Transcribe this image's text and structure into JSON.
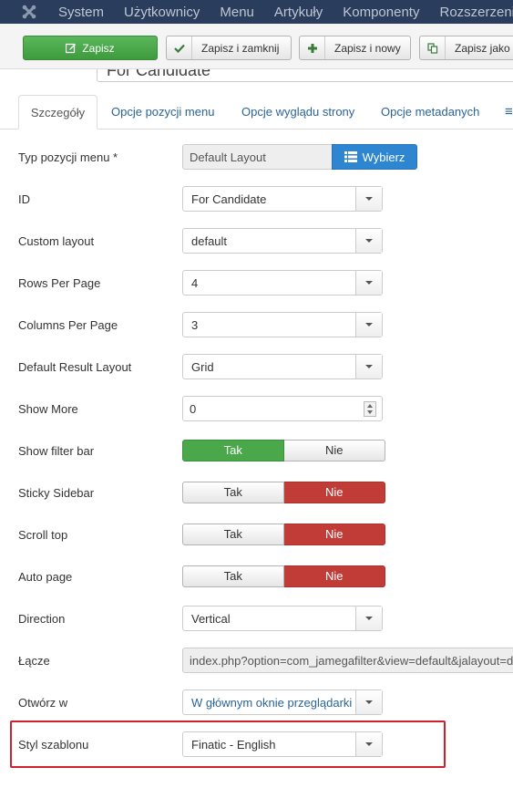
{
  "navbar": {
    "menu": [
      "System",
      "Użytkownicy",
      "Menu",
      "Artykuły",
      "Komponenty",
      "Rozszerzenia"
    ]
  },
  "toolbar": {
    "save": "Zapisz",
    "save_close": "Zapisz i zamknij",
    "save_new": "Zapisz i nowy",
    "save_copy": "Zapisz jako"
  },
  "title_field": {
    "label_fragment": "'",
    "value": "For Candidate"
  },
  "tabs": [
    "Szczegóły",
    "Opcje pozycji menu",
    "Opcje wyglądu strony",
    "Opcje metadanych",
    "≡"
  ],
  "form": {
    "menu_type": {
      "label": "Typ pozycji menu *",
      "value": "Default Layout",
      "button": "Wybierz"
    },
    "id": {
      "label": "ID",
      "value": "For Candidate"
    },
    "custom_layout": {
      "label": "Custom layout",
      "value": "default"
    },
    "rows_per_page": {
      "label": "Rows Per Page",
      "value": "4"
    },
    "columns_per_page": {
      "label": "Columns Per Page",
      "value": "3"
    },
    "default_result_layout": {
      "label": "Default Result Layout",
      "value": "Grid"
    },
    "show_more": {
      "label": "Show More",
      "value": "0"
    },
    "show_filter_bar": {
      "label": "Show filter bar",
      "yes": "Tak",
      "no": "Nie",
      "selected": "Tak"
    },
    "sticky_sidebar": {
      "label": "Sticky Sidebar",
      "yes": "Tak",
      "no": "Nie",
      "selected": "Nie"
    },
    "scroll_top": {
      "label": "Scroll top",
      "yes": "Tak",
      "no": "Nie",
      "selected": "Nie"
    },
    "auto_page": {
      "label": "Auto page",
      "yes": "Tak",
      "no": "Nie",
      "selected": "Nie"
    },
    "direction": {
      "label": "Direction",
      "value": "Vertical"
    },
    "link": {
      "label": "Łącze",
      "value": "index.php?option=com_jamegafilter&view=default&jalayout=default"
    },
    "open_in": {
      "label": "Otwórz w",
      "value": "W głównym oknie przeglądarki"
    },
    "template_style": {
      "label": "Styl szablonu",
      "value": "Finatic - English"
    }
  },
  "colors": {
    "navbar": "#2a3d5c",
    "save_green": "#4aa84a",
    "no_red": "#c23c37",
    "pick_blue": "#2f86d0",
    "highlight": "#d0202a"
  }
}
